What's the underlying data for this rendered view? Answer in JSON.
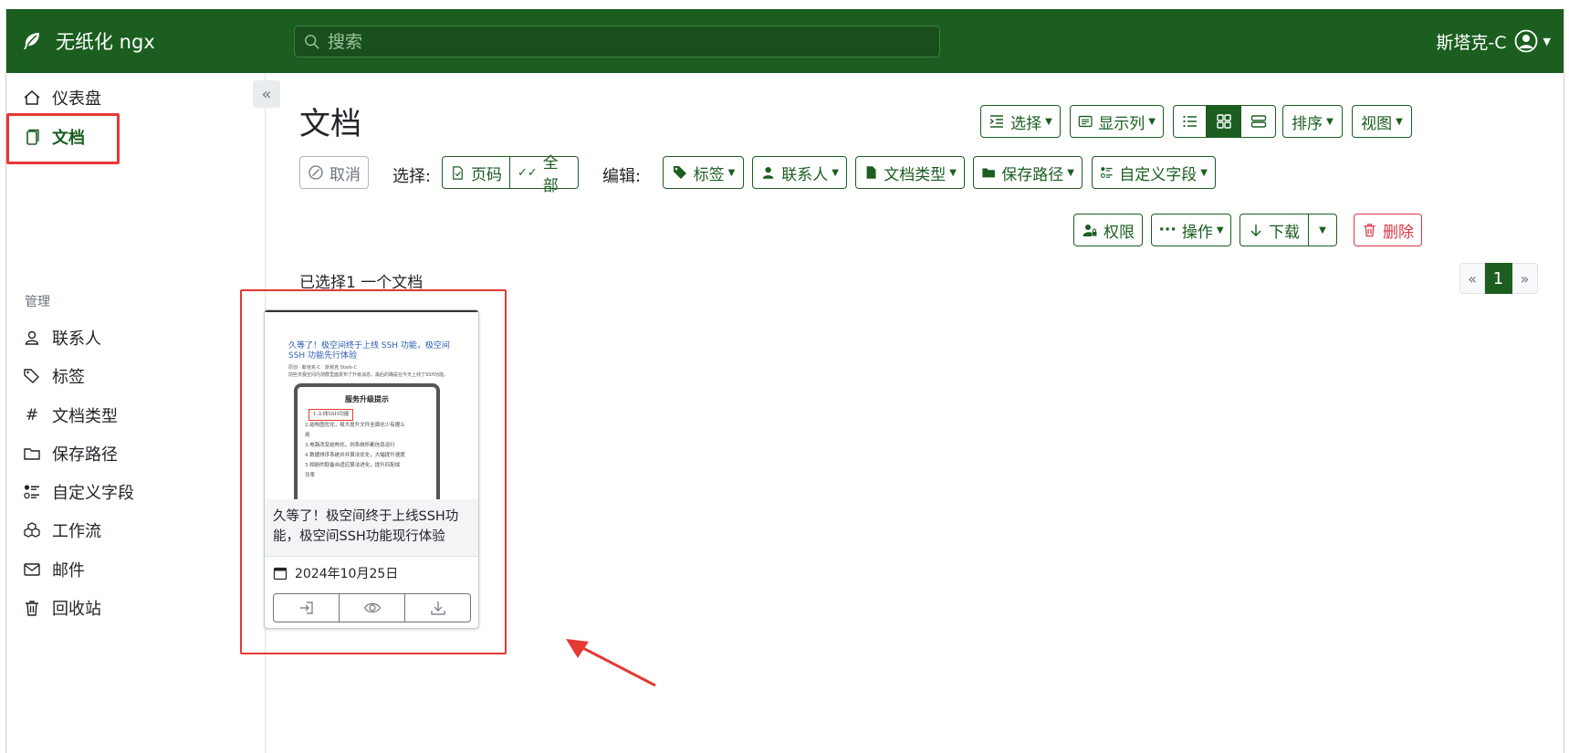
{
  "header": {
    "brand": "无纸化 ngx",
    "search_placeholder": "搜索",
    "user_name": "斯塔克-C"
  },
  "sidebar": {
    "items": [
      {
        "label": "仪表盘",
        "icon": "home-icon"
      },
      {
        "label": "文档",
        "icon": "documents-icon",
        "active": true
      }
    ],
    "section_title": "管理",
    "manage_items": [
      {
        "label": "联系人",
        "icon": "person-icon"
      },
      {
        "label": "标签",
        "icon": "tags-icon"
      },
      {
        "label": "文档类型",
        "icon": "hash-icon"
      },
      {
        "label": "保存路径",
        "icon": "folder-icon"
      },
      {
        "label": "自定义字段",
        "icon": "ui-radios-icon"
      },
      {
        "label": "工作流",
        "icon": "boxes-icon"
      },
      {
        "label": "邮件",
        "icon": "envelope-icon"
      },
      {
        "label": "回收站",
        "icon": "trash-icon"
      }
    ]
  },
  "main": {
    "title": "文档",
    "toolbar": {
      "select": "选择",
      "show_columns": "显示列",
      "sort": "排序",
      "view": "视图"
    },
    "selection_bar": {
      "cancel": "取消",
      "select_label": "选择:",
      "page": "页码",
      "all": "全部",
      "edit_label": "编辑:",
      "tags": "标签",
      "correspondent": "联系人",
      "doc_type": "文档类型",
      "storage_path": "保存路径",
      "custom_fields": "自定义字段"
    },
    "actions": {
      "permissions": "权限",
      "operations": "操作",
      "download": "下载",
      "delete": "删除"
    },
    "selected_status": "已选择1 一个文档",
    "pagination": {
      "prev": "«",
      "current": "1",
      "next": "»"
    },
    "card": {
      "title": "久等了！极空间终于上线SSH功能，极空间SSH功能现行体验",
      "date": "2024年10月25日",
      "thumb_title": "久等了！极空间终于上线 SSH 功能，极空间SSH 功能先行体验",
      "thumb_meta": "原创 · 斯塔克-C　斯塔克 Stark-C",
      "thumb_lead": "前些天极空间内测群里面发布了升级消息，最后的确是在今天上线了SSH功能。",
      "notice_title": "服务升级提示",
      "notice_lines": [
        "1.上线SSH功能",
        "2.结构图优化，极大提升文件全面化少有据么",
        "用",
        "3.电路改变结构化，则系统所都信息运行",
        "4.数据排序系统并并算法优化，大幅提升速度",
        "5.相册的取备自适应算法进化，提升匹配成",
        "功率"
      ]
    }
  },
  "colors": {
    "brand_green": "#1b5e20",
    "highlight_red": "#e53935",
    "danger": "#dc3545"
  }
}
